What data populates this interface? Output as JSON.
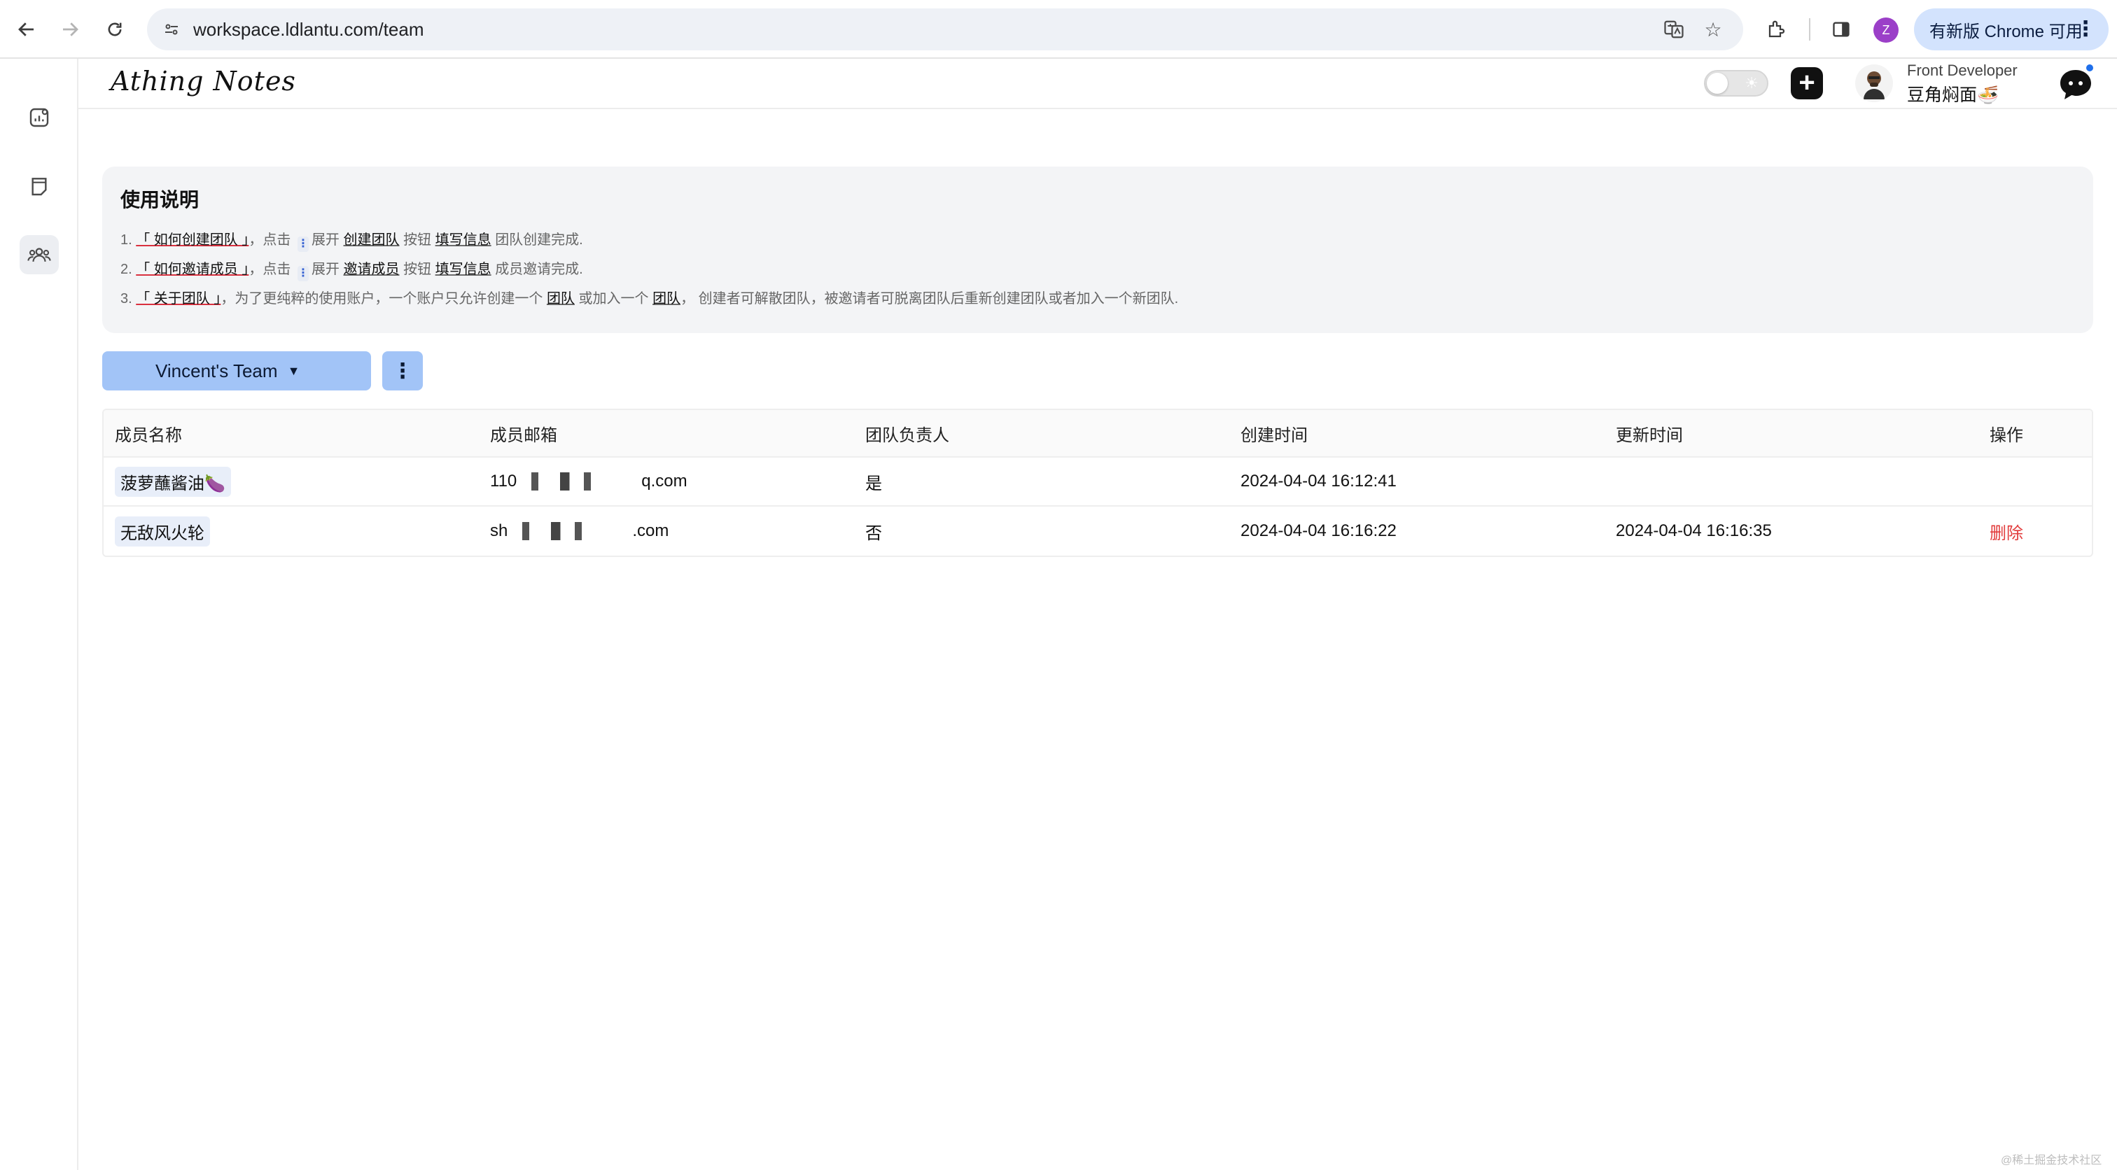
{
  "browser": {
    "url": "workspace.ldlantu.com/team",
    "profile_initial": "Z",
    "update_label": "有新版 Chrome 可用"
  },
  "header": {
    "logo": "Athing Notes",
    "user_role": "Front Developer",
    "user_name": "豆角焖面🍜"
  },
  "sidebar": {
    "items": [
      {
        "icon": "dashboard-icon",
        "active": false
      },
      {
        "icon": "notes-icon",
        "active": false
      },
      {
        "icon": "team-icon",
        "active": true
      }
    ]
  },
  "instructions": {
    "title": "使用说明",
    "lines": [
      {
        "num": "1.",
        "heading": "「 如何创建团队 」",
        "t1": "，点击",
        "t2": "展开",
        "k1": "创建团队",
        "t3": "按钮",
        "k2": "填写信息",
        "t4": "团队创建完成."
      },
      {
        "num": "2.",
        "heading": "「 如何邀请成员 」",
        "t1": "，点击",
        "t2": "展开",
        "k1": "邀请成员",
        "t3": "按钮",
        "k2": "填写信息",
        "t4": "成员邀请完成."
      },
      {
        "num": "3.",
        "heading": "「 关于团队 」",
        "t1": "，为了更纯粹的使用账户，一个账户只允许创建一个",
        "k1": "团队",
        "t2": "或加入一个",
        "k2": "团队",
        "t3": "，  创建者可解散团队，被邀请者可脱离团队后重新创建团队或者加入一个新团队."
      }
    ]
  },
  "team": {
    "selected": "Vincent's Team"
  },
  "table": {
    "columns": [
      "成员名称",
      "成员邮箱",
      "团队负责人",
      "创建时间",
      "更新时间",
      "操作"
    ],
    "rows": [
      {
        "name": "菠萝蘸酱油🍆",
        "email_prefix": "110",
        "email_suffix": "q.com",
        "leader": "是",
        "created": "2024-04-04 16:12:41",
        "updated": "",
        "action": ""
      },
      {
        "name": "无敌风火轮",
        "email_prefix": "sh",
        "email_suffix": ".com",
        "leader": "否",
        "created": "2024-04-04 16:16:22",
        "updated": "2024-04-04 16:16:35",
        "action": "删除"
      }
    ]
  },
  "footer": {
    "watermark": "@稀土掘金技术社区"
  }
}
